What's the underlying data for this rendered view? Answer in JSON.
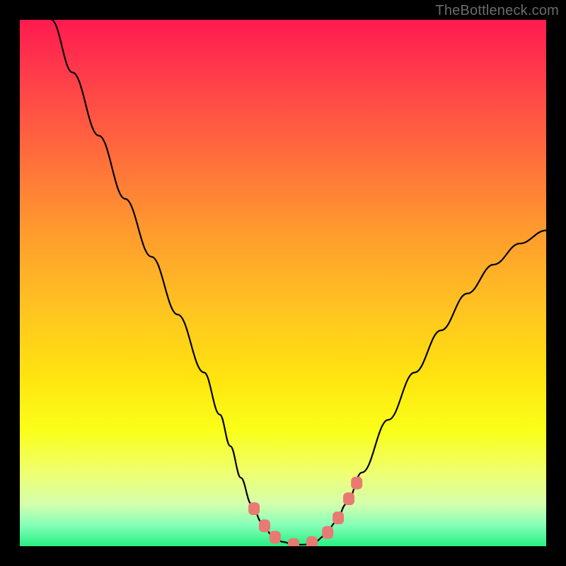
{
  "watermark": "TheBottleneck.com",
  "chart_data": {
    "type": "line",
    "title": "",
    "xlabel": "",
    "ylabel": "",
    "xlim": [
      0,
      100
    ],
    "ylim": [
      0,
      100
    ],
    "series": [
      {
        "name": "curve",
        "x": [
          6,
          10,
          15,
          20,
          25,
          30,
          35,
          38,
          40,
          42,
          44,
          46,
          48,
          50,
          52,
          54,
          56,
          58,
          60,
          62,
          65,
          70,
          75,
          80,
          85,
          90,
          95,
          100
        ],
        "y": [
          100,
          90,
          78,
          66,
          55,
          44,
          33,
          25,
          19,
          13,
          8,
          4.5,
          2,
          0.8,
          0.3,
          0.3,
          0.8,
          2,
          4.5,
          8,
          14,
          24,
          33,
          41,
          48,
          53.5,
          57.5,
          60
        ]
      }
    ],
    "sweet_spot_markers_x": [
      44.5,
      46.5,
      48.5,
      52,
      55.5,
      58.5,
      60.5,
      62.5,
      64
    ]
  }
}
